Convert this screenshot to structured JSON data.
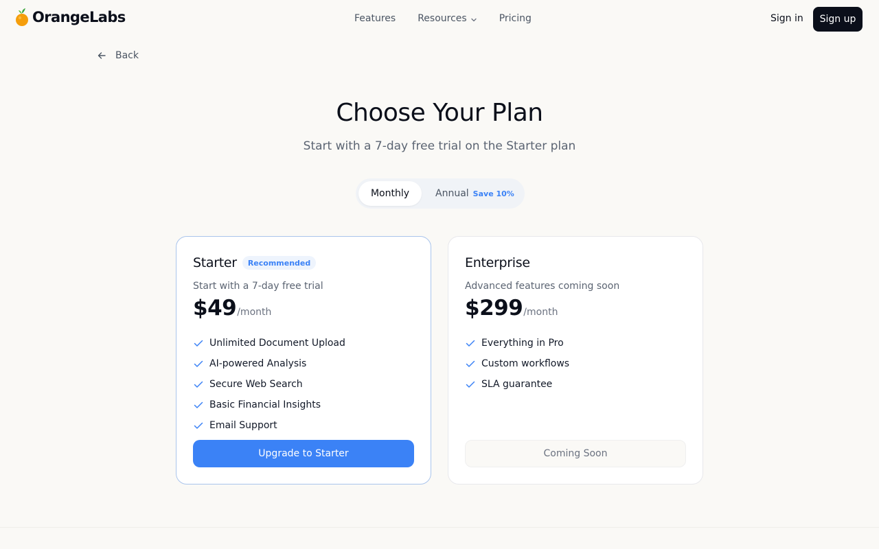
{
  "brand": {
    "name": "OrangeLabs",
    "accent": "#3b82f6",
    "dark": "#0b0f1a"
  },
  "nav": {
    "items": [
      "Features",
      "Resources",
      "Pricing"
    ],
    "signin": "Sign in",
    "signup": "Sign up"
  },
  "back": "Back",
  "header": {
    "title": "Choose Your Plan",
    "subtitle": "Start with a 7-day free trial on the Starter plan"
  },
  "billing_toggle": {
    "monthly": "Monthly",
    "annual": "Annual",
    "save": "Save 10%",
    "selected": "Monthly"
  },
  "plans": [
    {
      "name": "Starter",
      "badge": "Recommended",
      "description": "Start with a 7-day free trial",
      "price": "$49",
      "period": "/month",
      "features": [
        "Unlimited Document Upload",
        "AI-powered Analysis",
        "Secure Web Search",
        "Basic Financial Insights",
        "Email Support"
      ],
      "cta": "Upgrade to Starter"
    },
    {
      "name": "Enterprise",
      "description": "Advanced features coming soon",
      "price": "$299",
      "period": "/month",
      "features": [
        "Everything in Pro",
        "Custom workflows",
        "SLA guarantee"
      ],
      "cta": "Coming Soon"
    }
  ]
}
